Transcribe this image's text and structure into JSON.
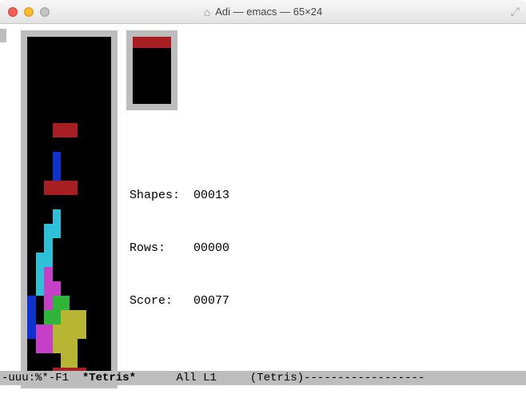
{
  "window": {
    "title": "Adi — emacs — 65×24"
  },
  "stats": {
    "labels": {
      "shapes": "Shapes:",
      "rows": "Rows:",
      "score": "Score:"
    },
    "shapes": "00013",
    "rows": "00000",
    "score": "00077"
  },
  "modeline": {
    "left": "-uuu:%*-F1",
    "buffer": "*Tetris*",
    "pos": "All L1",
    "mode": "(Tetris)",
    "dashes": "------------------"
  },
  "colors": {
    "empty": "#000000",
    "red": "#a71f23",
    "blue": "#0f32ce",
    "cyan": "#2dc0d8",
    "magenta": "#c63fc7",
    "green": "#2fb53a",
    "olive": "#b7b534"
  },
  "board": {
    "cols": 10,
    "rows": 24,
    "grid": [
      ".......... ",
      "..........",
      "..........",
      "..........",
      "..........",
      "..........",
      "...RRR....",
      "..........",
      "...B......",
      "...B......",
      "..RRRR....",
      "..........",
      "...C......",
      "..CC......",
      "..C.......",
      ".CC.......",
      ".CM.......",
      ".CMM......",
      "B.MGG.....",
      "B.GGOOO...",
      "BMMOOOO...",
      ".MMOOO....",
      "....OO....",
      "...RRRR..."
    ],
    "legend": {
      ".": "empty",
      "R": "red",
      "B": "blue",
      "C": "cyan",
      "M": "magenta",
      "G": "green",
      "O": "olive"
    }
  },
  "next_piece": {
    "cols": 4,
    "rows": 6,
    "grid": [
      "RRRR",
      "....",
      "....",
      "....",
      "....",
      "...."
    ],
    "legend": {
      ".": "empty",
      "R": "red"
    }
  },
  "chart_data": {
    "type": "table",
    "title": "Tetris game state (emacs tetris)",
    "series": [
      {
        "name": "Shapes",
        "values": [
          13
        ]
      },
      {
        "name": "Rows",
        "values": [
          0
        ]
      },
      {
        "name": "Score",
        "values": [
          77
        ]
      }
    ]
  }
}
